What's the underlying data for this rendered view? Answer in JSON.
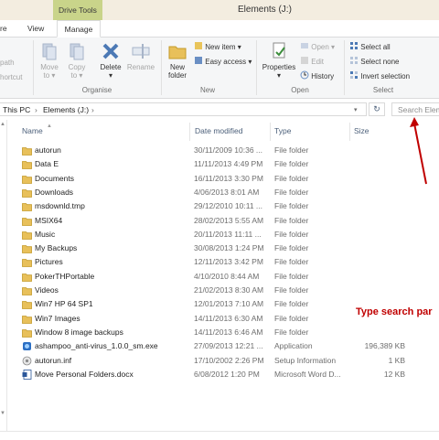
{
  "titlebar": {
    "context_tab": "Drive Tools",
    "title": "Elements (J:)"
  },
  "tabs": {
    "share": "re",
    "view": "View",
    "manage": "Manage"
  },
  "ribbon": {
    "left": {
      "path_label": "path",
      "shortcut_label": "hortcut"
    },
    "organise": {
      "label": "Organise",
      "move_to": "Move",
      "move_to_2": "to",
      "copy_to": "Copy",
      "copy_to_2": "to",
      "delete": "Delete",
      "rename": "Rename"
    },
    "new": {
      "label": "New",
      "new_folder": "New",
      "new_folder_2": "folder",
      "new_item": "New item",
      "easy_access": "Easy access"
    },
    "open": {
      "label": "Open",
      "properties": "Properties",
      "open": "Open",
      "edit": "Edit",
      "history": "History"
    },
    "select": {
      "label": "Select",
      "select_all": "Select all",
      "select_none": "Select none",
      "invert": "Invert selection"
    }
  },
  "address": {
    "crumb_this_pc": "This PC",
    "crumb_drive": "Elements (J:)",
    "search_placeholder": "Search Elem"
  },
  "columns": {
    "name": "Name",
    "date": "Date modified",
    "type": "Type",
    "size": "Size"
  },
  "files": [
    {
      "name": "autorun",
      "date": "30/11/2009 10:36 ...",
      "type": "File folder",
      "size": "",
      "icon": "folder"
    },
    {
      "name": "Data E",
      "date": "11/11/2013 4:49 PM",
      "type": "File folder",
      "size": "",
      "icon": "folder"
    },
    {
      "name": "Documents",
      "date": "16/11/2013 3:30 PM",
      "type": "File folder",
      "size": "",
      "icon": "folder"
    },
    {
      "name": "Downloads",
      "date": "4/06/2013 8:01 AM",
      "type": "File folder",
      "size": "",
      "icon": "folder"
    },
    {
      "name": "msdownld.tmp",
      "date": "29/12/2010 10:11 ...",
      "type": "File folder",
      "size": "",
      "icon": "folder"
    },
    {
      "name": "MSIX64",
      "date": "28/02/2013 5:55 AM",
      "type": "File folder",
      "size": "",
      "icon": "folder"
    },
    {
      "name": "Music",
      "date": "20/11/2013 11:11 ...",
      "type": "File folder",
      "size": "",
      "icon": "folder"
    },
    {
      "name": "My Backups",
      "date": "30/08/2013 1:24 PM",
      "type": "File folder",
      "size": "",
      "icon": "folder"
    },
    {
      "name": "Pictures",
      "date": "12/11/2013 3:42 PM",
      "type": "File folder",
      "size": "",
      "icon": "folder"
    },
    {
      "name": "PokerTHPortable",
      "date": "4/10/2010 8:44 AM",
      "type": "File folder",
      "size": "",
      "icon": "folder"
    },
    {
      "name": "Videos",
      "date": "21/02/2013 8:30 AM",
      "type": "File folder",
      "size": "",
      "icon": "folder"
    },
    {
      "name": "Win7 HP 64 SP1",
      "date": "12/01/2013 7:10 AM",
      "type": "File folder",
      "size": "",
      "icon": "folder"
    },
    {
      "name": "Win7 Images",
      "date": "14/11/2013 6:30 AM",
      "type": "File folder",
      "size": "",
      "icon": "folder"
    },
    {
      "name": "Window 8 image backups",
      "date": "14/11/2013 6:46 AM",
      "type": "File folder",
      "size": "",
      "icon": "folder"
    },
    {
      "name": "ashampoo_anti-virus_1.0.0_sm.exe",
      "date": "27/09/2013 12:21 ...",
      "type": "Application",
      "size": "196,389 KB",
      "icon": "exe"
    },
    {
      "name": "autorun.inf",
      "date": "17/10/2002 2:26 PM",
      "type": "Setup Information",
      "size": "1 KB",
      "icon": "inf"
    },
    {
      "name": "Move Personal Folders.docx",
      "date": "6/08/2012 1:20 PM",
      "type": "Microsoft Word D...",
      "size": "12 KB",
      "icon": "docx"
    }
  ],
  "annotation": "Type search par",
  "colors": {
    "accent": "#c00000",
    "drive_tools": "#c9d48a",
    "titlebar": "#f3ede0",
    "folder": "#e8c05a"
  }
}
